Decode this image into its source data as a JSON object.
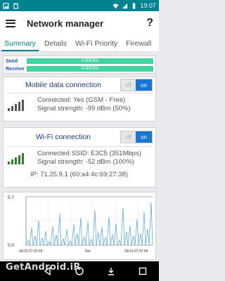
{
  "status_bar": {
    "time": "19:07",
    "battery": "",
    "icons": [
      "image-icon",
      "clipboard-icon",
      "wifi-icon",
      "signal-icon",
      "battery-icon"
    ]
  },
  "app": {
    "title": "Network manager",
    "help_label": "?"
  },
  "tabs": [
    {
      "label": "Summary",
      "active": true
    },
    {
      "label": "Details",
      "active": false
    },
    {
      "label": "Wi-Fi Priority",
      "active": false
    },
    {
      "label": "Firewall",
      "active": false
    },
    {
      "label": "D",
      "active": false
    }
  ],
  "traffic": {
    "send_label": "Send",
    "send_value": "0.00KB/s",
    "receive_label": "Receive",
    "receive_value": "0.00KB/s"
  },
  "mobile": {
    "title": "Mobile data connection",
    "toggle_off": "off",
    "toggle_on": "on",
    "connected": "Connected: Yes (GSM - Free)",
    "signal": "Signal strength: -99 dBm (50%)"
  },
  "wifi": {
    "title": "Wi-Fi connection",
    "toggle_off": "off",
    "toggle_on": "on",
    "connected": "Connected SSID: E3C5 (351Mbps)",
    "signal": "Signal strength: -52 dBm (100%)",
    "ip": "IP: 71.25.9.1 (60:a4:4c:69:27:38)"
  },
  "graph": {
    "y_max_label": "5.7",
    "y_min_label": "0.0",
    "x_start_label": "06/19 07:02:06",
    "x_center_label": "Net",
    "x_end_label": "06/19 07:07:06"
  },
  "watermark": "GetAndroid.iR",
  "colors": {
    "accent": "#00838f",
    "toggle_on": "#1976d2",
    "traffic_bar": "#3fd4a0",
    "graph_line": "#4aa3df"
  }
}
